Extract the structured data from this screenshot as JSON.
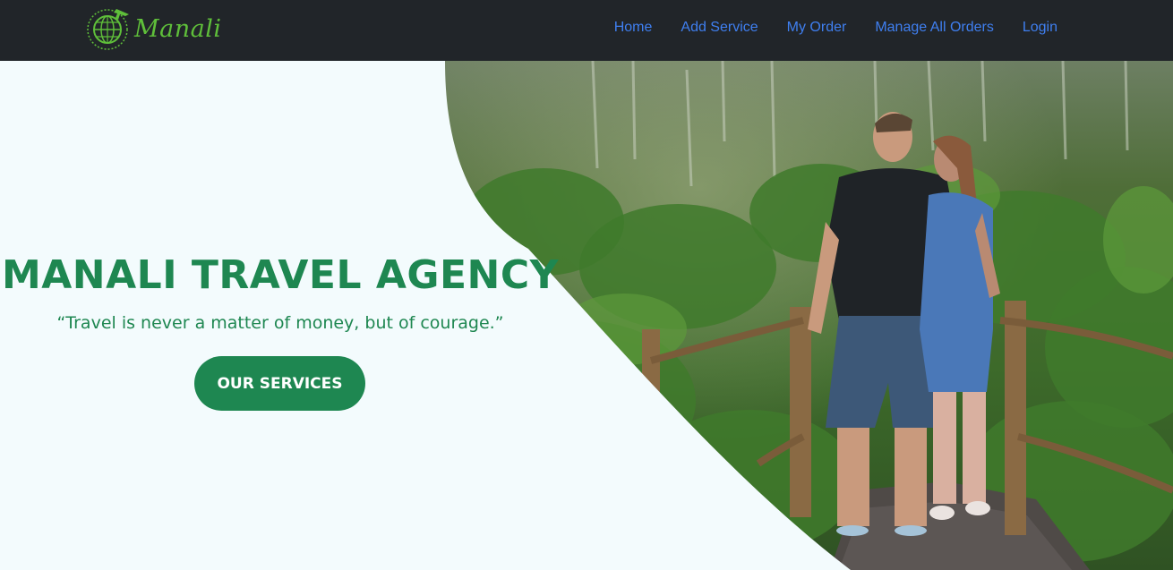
{
  "navbar": {
    "brand": {
      "name": "Manali",
      "icon": "globe-plane-icon"
    },
    "links": [
      {
        "label": "Home"
      },
      {
        "label": "Add Service"
      },
      {
        "label": "My Order"
      },
      {
        "label": "Manage All Orders"
      },
      {
        "label": "Login"
      }
    ]
  },
  "hero": {
    "title": "MANALI TRAVEL AGENCY",
    "quote": "“Travel is never a matter of money, but of courage.”",
    "cta_label": "OUR SERVICES",
    "photo": "couple-on-jungle-boardwalk-photo"
  },
  "colors": {
    "navbar_bg": "#212529",
    "nav_link": "#3f7ff0",
    "brand_green": "#5fbf3a",
    "accent_green": "#1e8751",
    "hero_bg": "#f3fbfd"
  }
}
